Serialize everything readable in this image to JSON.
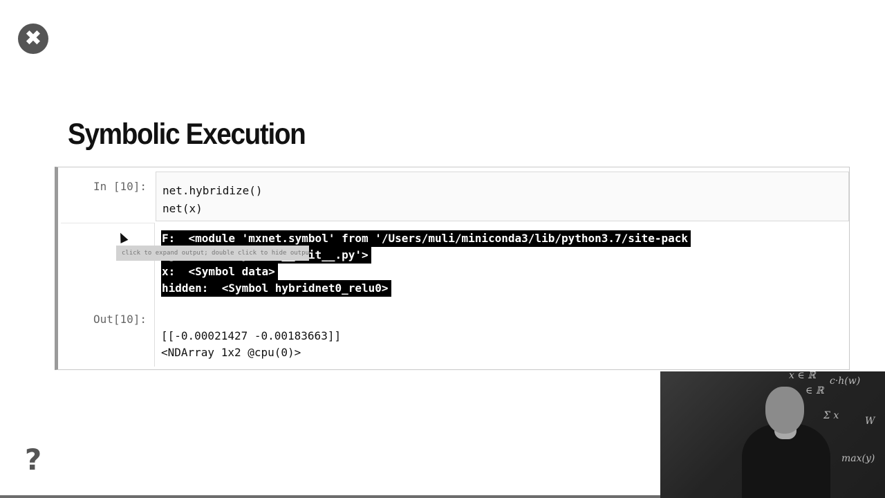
{
  "slide": {
    "close_symbol": "✖",
    "help_symbol": "?",
    "title": "Symbolic Execution"
  },
  "cell": {
    "in_prompt": "In [10]:",
    "out_prompt": "Out[10]:",
    "input_code": [
      "net.hybridize()",
      "net(x)"
    ],
    "stream_output": [
      "F:  <module 'mxnet.symbol' from '/Users/muli/miniconda3/lib/python3.7/site-pack",
      "ages/mxnet/symbol/__init__.py'>",
      "x:  <Symbol data>",
      "hidden:  <Symbol hybridnet0_relu0>"
    ],
    "result_output": [
      "[[-0.00021427 -0.00183663]]",
      "<NDArray 1x2 @cpu(0)>"
    ],
    "tooltip": "click to expand output; double click to hide output"
  },
  "video": {
    "board_scribbles": [
      "x ∈ ℝ",
      "c·h(w)",
      "∈ ℝ",
      "Σ x",
      "W",
      "max(y)"
    ]
  },
  "colors": {
    "highlight_bg": "#000000",
    "highlight_fg": "#ffffff",
    "cell_border": "#9a9a9a",
    "icon_gray": "#555555"
  },
  "icons": {
    "close": "close-icon",
    "help": "help-icon",
    "cursor": "mouse-pointer-icon"
  }
}
